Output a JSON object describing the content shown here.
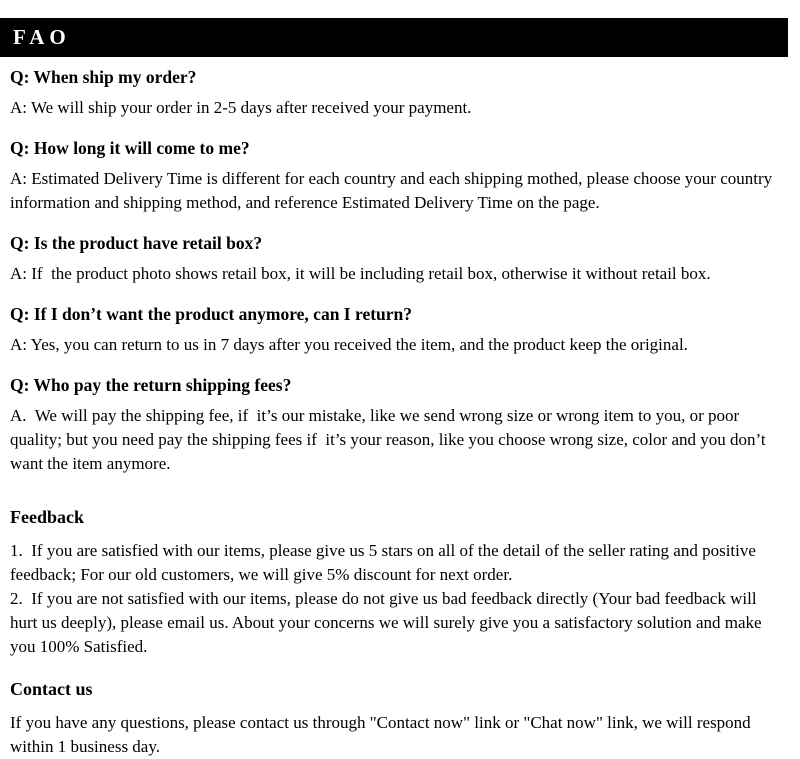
{
  "banner": {
    "title": "FAO"
  },
  "faq": {
    "items": [
      {
        "question": "Q: When ship my order?",
        "answer": "A: We will ship your order in 2-5 days after received your payment."
      },
      {
        "question": "Q: How long it will come to me?",
        "answer": "A: Estimated Delivery Time is different for each country and each shipping mothed, please choose your country information and shipping method, and reference Estimated Delivery Time on the page."
      },
      {
        "question": "Q: Is the product have retail box?",
        "answer": "A: If  the product photo shows retail box, it will be including retail box, otherwise it without retail box."
      },
      {
        "question": "Q: If I don’t want the product anymore, can I return?",
        "answer": "A: Yes, you can return to us in 7 days after you received the item, and the product keep the original."
      },
      {
        "question": "Q: Who pay the return shipping fees?",
        "answer": "A.  We will pay the shipping fee, if  it’s our mistake, like we send wrong size or wrong item to you, or poor quality; but you need pay the shipping fees if  it’s your reason, like you choose wrong size, color and you don’t want the item anymore."
      }
    ]
  },
  "feedback": {
    "heading": "Feedback",
    "paragraph": "1.  If you are satisfied with our items, please give us 5 stars on all of the detail of the seller rating and positive feedback; For our old customers, we will give 5% discount for next order.\n2.  If you are not satisfied with our items, please do not give us bad feedback directly (Your bad feedback will hurt us deeply), please email us. About your concerns we will surely give you a satisfactory solution and make you 100% Satisfied."
  },
  "contact": {
    "heading": "Contact us",
    "paragraph": "If you have any questions, please contact us through \"Contact now\" link or \"Chat now\" link, we will respond within 1 business day."
  },
  "colors": {
    "banner_background": "#000000",
    "banner_text": "#ffffff",
    "page_background": "#ffffff",
    "body_text": "#000000"
  }
}
